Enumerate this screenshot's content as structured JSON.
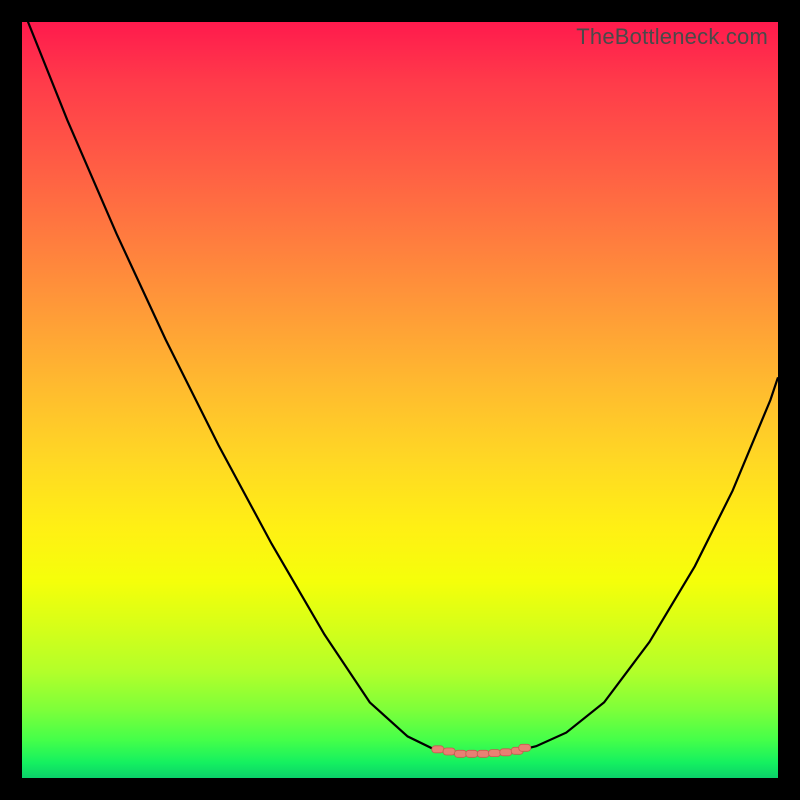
{
  "watermark": "TheBottleneck.com",
  "colors": {
    "background": "#000000",
    "curve_stroke": "#000000",
    "marker_fill": "#e88073",
    "marker_stroke": "#c85a50"
  },
  "chart_data": {
    "type": "line",
    "title": "",
    "xlabel": "",
    "ylabel": "",
    "xlim": [
      0,
      100
    ],
    "ylim": [
      0,
      100
    ],
    "grid": false,
    "series": [
      {
        "name": "left-curve",
        "x": [
          0,
          6,
          12.5,
          19,
          26,
          33,
          40,
          46,
          51,
          54.5,
          57,
          58
        ],
        "values": [
          102,
          87,
          72,
          58,
          44,
          31,
          19,
          10,
          5.5,
          3.8,
          3.3,
          3.2
        ]
      },
      {
        "name": "right-curve",
        "x": [
          58,
          62,
          65.5,
          68,
          72,
          77,
          83,
          89,
          94,
          99,
          100
        ],
        "values": [
          3.2,
          3.3,
          3.6,
          4.2,
          6,
          10,
          18,
          28,
          38,
          50,
          53
        ]
      }
    ],
    "markers": {
      "name": "flat-minimum",
      "x": [
        55,
        56.5,
        58,
        59.5,
        61,
        62.5,
        64,
        65.5,
        66.5
      ],
      "values": [
        3.8,
        3.5,
        3.2,
        3.2,
        3.2,
        3.3,
        3.4,
        3.6,
        4.0
      ]
    }
  }
}
